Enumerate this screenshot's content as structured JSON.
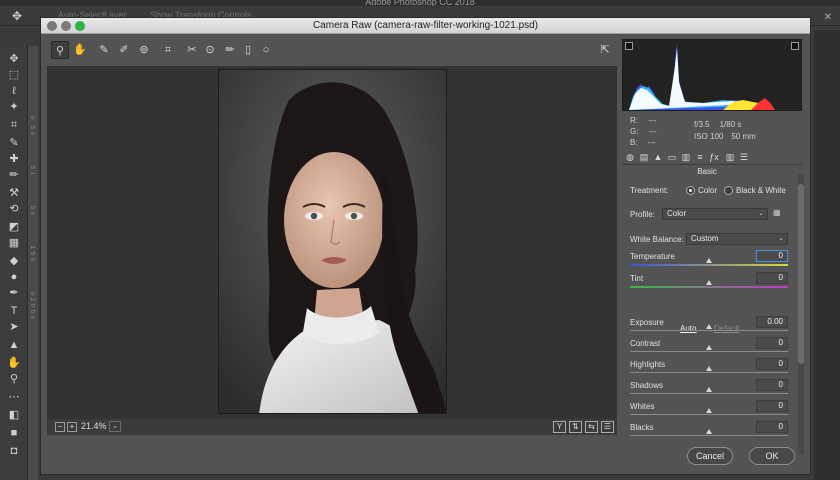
{
  "photoshop": {
    "title": "Adobe Photoshop CC 2018",
    "options_labels": [
      "Auto-Select:",
      "Layer",
      "Show Transform Controls"
    ],
    "ruler_ticks": [
      "0",
      "5",
      "0",
      "5",
      "1",
      "0",
      "0",
      "1",
      "5",
      "0",
      "0",
      "2",
      "0",
      "0",
      "0"
    ]
  },
  "dialog": {
    "title": "Camera Raw (camera-raw-filter-working-1021.psd)",
    "traffic_colors": [
      "#7a7a7a",
      "#7a7a7a",
      "#2ab24b"
    ]
  },
  "toolbar": {
    "tools": [
      {
        "name": "zoom-tool-icon",
        "glyph": "⚲"
      },
      {
        "name": "hand-tool-icon",
        "glyph": "✋"
      },
      {
        "name": "white-balance-tool-icon",
        "glyph": "✎"
      },
      {
        "name": "color-sampler-tool-icon",
        "glyph": "✐"
      },
      {
        "name": "targeted-adjustment-tool-icon",
        "glyph": "⊚"
      },
      {
        "name": "transform-tool-icon",
        "glyph": "⌗"
      },
      {
        "name": "spot-removal-tool-icon",
        "glyph": "✂"
      },
      {
        "name": "red-eye-removal-icon",
        "glyph": "⊙"
      },
      {
        "name": "adjustment-brush-icon",
        "glyph": "✏"
      },
      {
        "name": "graduated-filter-icon",
        "glyph": "▯"
      },
      {
        "name": "radial-filter-icon",
        "glyph": "○"
      }
    ],
    "fullscreen_glyph": "⇱"
  },
  "status": {
    "zoom_minus": "−",
    "zoom_plus": "+",
    "zoom_level": "21.4%",
    "zoom_arrow": "⌄",
    "view_buttons": [
      "Y",
      "⇅",
      "⇆",
      "☰"
    ]
  },
  "histogram_colors": {
    "red": "#ff3333",
    "yellow": "#ffe633",
    "white": "#ffffff",
    "cyan": "#33ccff",
    "blue": "#4455ff"
  },
  "readout": {
    "r_label": "R:",
    "r_value": "---",
    "g_label": "G:",
    "g_value": "---",
    "b_label": "B:",
    "b_value": "---",
    "aperture": "f/3.5",
    "shutter": "1/80 s",
    "iso": "ISO 100",
    "focal": "50 mm"
  },
  "panel_tabs": [
    "◍",
    "▤",
    "▲",
    "▭",
    "▥",
    "≡",
    "ƒx",
    "▥",
    "☰"
  ],
  "basic": {
    "title": "Basic",
    "treatment_label": "Treatment:",
    "treatment_color": "Color",
    "treatment_bw": "Black & White",
    "profile_label": "Profile:",
    "profile_value": "Color",
    "wb_label": "White Balance:",
    "wb_value": "Custom",
    "auto": "Auto",
    "default": "Default",
    "sliders": [
      {
        "label": "Temperature",
        "value": "0",
        "pos": 0.5
      },
      {
        "label": "Tint",
        "value": "0",
        "pos": 0.5
      },
      {
        "label": "Exposure",
        "value": "0.00",
        "pos": 0.5
      },
      {
        "label": "Contrast",
        "value": "0",
        "pos": 0.5
      },
      {
        "label": "Highlights",
        "value": "0",
        "pos": 0.5
      },
      {
        "label": "Shadows",
        "value": "0",
        "pos": 0.5
      },
      {
        "label": "Whites",
        "value": "0",
        "pos": 0.5
      },
      {
        "label": "Blacks",
        "value": "0",
        "pos": 0.5
      }
    ]
  },
  "buttons": {
    "cancel": "Cancel",
    "ok": "OK"
  }
}
